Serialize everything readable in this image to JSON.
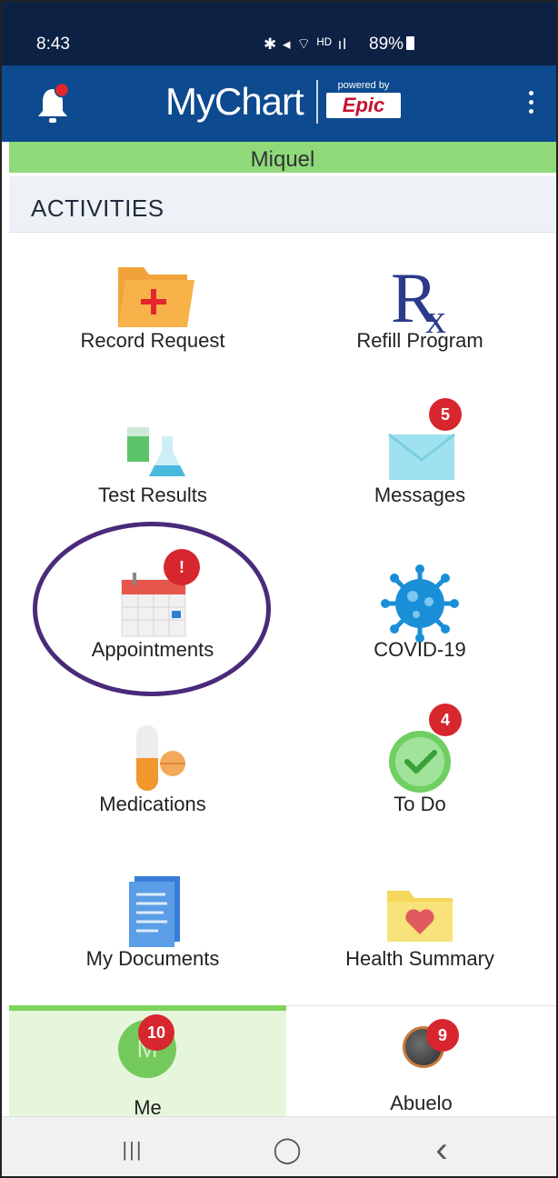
{
  "status_bar": {
    "time": "8:43",
    "icons": "✱ ◂ ⌔ ᴴᴰ ıl",
    "battery": "89%"
  },
  "header": {
    "app_name": "MyChart",
    "powered_by": "powered by",
    "brand": "Epic",
    "accent_color": "#0d4a8f"
  },
  "patient": {
    "name": "Miquel"
  },
  "section": {
    "title": "ACTIVITIES"
  },
  "activities": [
    {
      "label": "Record Request",
      "icon": "folder-plus-icon"
    },
    {
      "label": "Refill Program",
      "icon": "rx-icon"
    },
    {
      "label": "Test Results",
      "icon": "lab-beakers-icon"
    },
    {
      "label": "Messages",
      "icon": "envelope-icon",
      "badge": "5"
    },
    {
      "label": "Appointments",
      "icon": "calendar-icon",
      "badge": "!"
    },
    {
      "label": "COVID-19",
      "icon": "virus-icon"
    },
    {
      "label": "Medications",
      "icon": "pill-icon"
    },
    {
      "label": "To Do",
      "icon": "clock-check-icon",
      "badge": "4"
    },
    {
      "label": "My Documents",
      "icon": "document-icon"
    },
    {
      "label": "Health Summary",
      "icon": "folder-heart-icon"
    }
  ],
  "tabs": [
    {
      "label": "Me",
      "badge": "10",
      "avatar_letter": "M",
      "active": true
    },
    {
      "label": "Abuelo",
      "badge": "9",
      "active": false
    }
  ],
  "nav": {
    "recent": "|||",
    "home": "◯",
    "back": "‹"
  }
}
